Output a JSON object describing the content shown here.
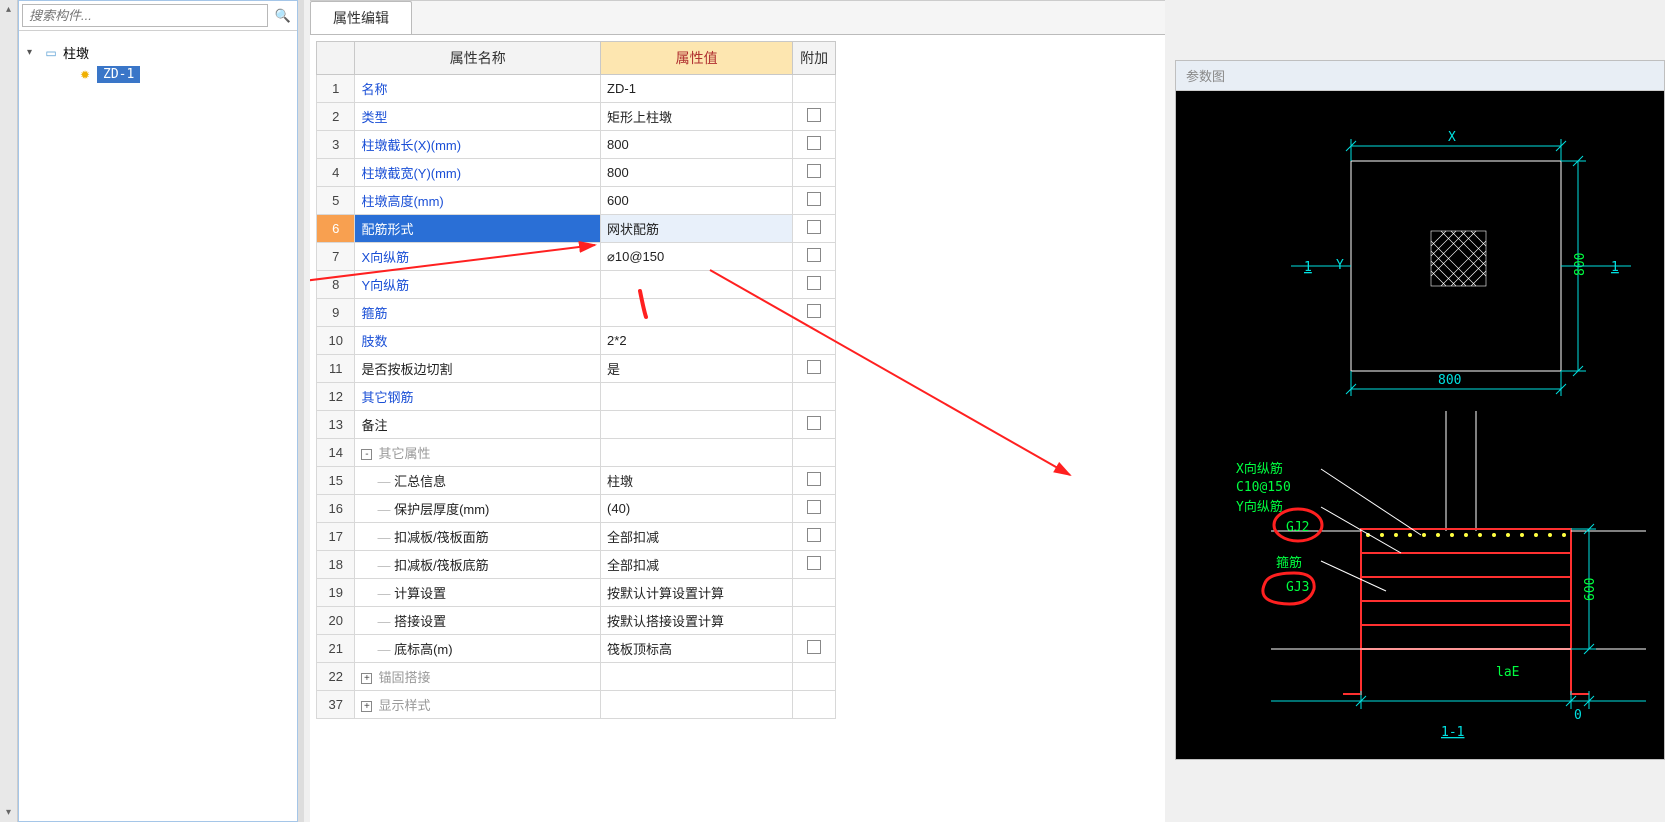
{
  "search": {
    "placeholder": "搜索构件..."
  },
  "tree": {
    "root_label": "柱墩",
    "child_label": "ZD-1"
  },
  "tab": {
    "label": "属性编辑"
  },
  "headers": {
    "name": "属性名称",
    "value": "属性值",
    "add": "附加"
  },
  "rows": [
    {
      "n": "1",
      "name": "名称",
      "val": "ZD-1",
      "link": true,
      "chk": false
    },
    {
      "n": "2",
      "name": "类型",
      "val": "矩形上柱墩",
      "link": true,
      "chk": true
    },
    {
      "n": "3",
      "name": "柱墩截长(X)(mm)",
      "val": "800",
      "link": true,
      "chk": true
    },
    {
      "n": "4",
      "name": "柱墩截宽(Y)(mm)",
      "val": "800",
      "link": true,
      "chk": true
    },
    {
      "n": "5",
      "name": "柱墩高度(mm)",
      "val": "600",
      "link": true,
      "chk": true
    },
    {
      "n": "6",
      "name": "配筋形式",
      "val": "网状配筋",
      "link": true,
      "chk": true,
      "selected": true
    },
    {
      "n": "7",
      "name": "X向纵筋",
      "val": "⌀10@150",
      "link": true,
      "chk": true
    },
    {
      "n": "8",
      "name": "Y向纵筋",
      "val": "",
      "link": true,
      "chk": true
    },
    {
      "n": "9",
      "name": "箍筋",
      "val": "",
      "link": true,
      "chk": true
    },
    {
      "n": "10",
      "name": "肢数",
      "val": "2*2",
      "link": true,
      "chk": false
    },
    {
      "n": "11",
      "name": "是否按板边切割",
      "val": "是",
      "link": false,
      "chk": true
    },
    {
      "n": "12",
      "name": "其它钢筋",
      "val": "",
      "link": true,
      "chk": false
    },
    {
      "n": "13",
      "name": "备注",
      "val": "",
      "link": false,
      "chk": true
    },
    {
      "n": "14",
      "name": "其它属性",
      "val": "",
      "gray": true,
      "exp": "-"
    },
    {
      "n": "15",
      "name": "汇总信息",
      "val": "柱墩",
      "indent": true,
      "chk": true
    },
    {
      "n": "16",
      "name": "保护层厚度(mm)",
      "val": "(40)",
      "indent": true,
      "chk": true
    },
    {
      "n": "17",
      "name": "扣减板/筏板面筋",
      "val": "全部扣减",
      "indent": true,
      "chk": true
    },
    {
      "n": "18",
      "name": "扣减板/筏板底筋",
      "val": "全部扣减",
      "indent": true,
      "chk": true
    },
    {
      "n": "19",
      "name": "计算设置",
      "val": "按默认计算设置计算",
      "indent": true
    },
    {
      "n": "20",
      "name": "搭接设置",
      "val": "按默认搭接设置计算",
      "indent": true
    },
    {
      "n": "21",
      "name": "底标高(m)",
      "val": "筏板顶标高",
      "indent": true,
      "chk": true
    },
    {
      "n": "22",
      "name": "锚固搭接",
      "val": "",
      "gray": true,
      "exp": "+"
    },
    {
      "n": "37",
      "name": "显示样式",
      "val": "",
      "gray": true,
      "exp": "+"
    }
  ],
  "right": {
    "title": "参数图"
  },
  "cad": {
    "x_label": "X",
    "y_label": "Y",
    "dim_w": "800",
    "dim_h": "800",
    "dim_h2": "600",
    "one_top_l": "1",
    "one_top_r": "1",
    "xr": "X向纵筋",
    "xr_val": "C10@150",
    "yr": "Y向纵筋",
    "gj2": "GJ2",
    "gj_label": "箍筋",
    "gj3": "GJ3",
    "lae": "laE",
    "zero": "0",
    "section": "1-1"
  }
}
